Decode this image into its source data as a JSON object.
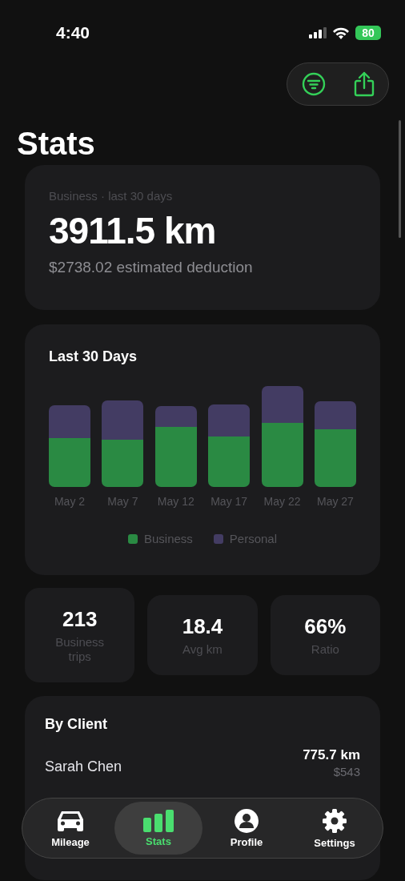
{
  "status_bar": {
    "time": "4:40",
    "battery": "80"
  },
  "toolbar": [
    {
      "kind": "filter"
    },
    {
      "kind": "share"
    }
  ],
  "title": "Stats",
  "summary": {
    "caption": "Business · last 30 days",
    "distance": "3911.5 km",
    "deduction": "$2738.02 estimated deduction"
  },
  "chart_card": {
    "title": "Last 30 Days",
    "categories": [
      "May 2",
      "May 7",
      "May 12",
      "May 17",
      "May 22",
      "May 27"
    ],
    "legend": [
      {
        "label": "Business",
        "color": "#2a8a43"
      },
      {
        "label": "Personal",
        "color": "#433c63"
      }
    ]
  },
  "metrics": [
    {
      "value": "213",
      "label": "Business trips",
      "raised": true
    },
    {
      "value": "18.4",
      "label": "Avg km",
      "raised": false
    },
    {
      "value": "66%",
      "label": "Ratio",
      "raised": false
    }
  ],
  "clients": {
    "title": "By Client",
    "rows": [
      {
        "name": "Sarah Chen",
        "distance": "775.7 km",
        "amount": "$543"
      }
    ]
  },
  "tab_bar": [
    {
      "kind": "car",
      "label": "Mileage",
      "selected": false
    },
    {
      "kind": "stats",
      "label": "Stats",
      "selected": true
    },
    {
      "kind": "person",
      "label": "Profile",
      "selected": false
    },
    {
      "kind": "gear",
      "label": "Settings",
      "selected": false
    }
  ]
}
